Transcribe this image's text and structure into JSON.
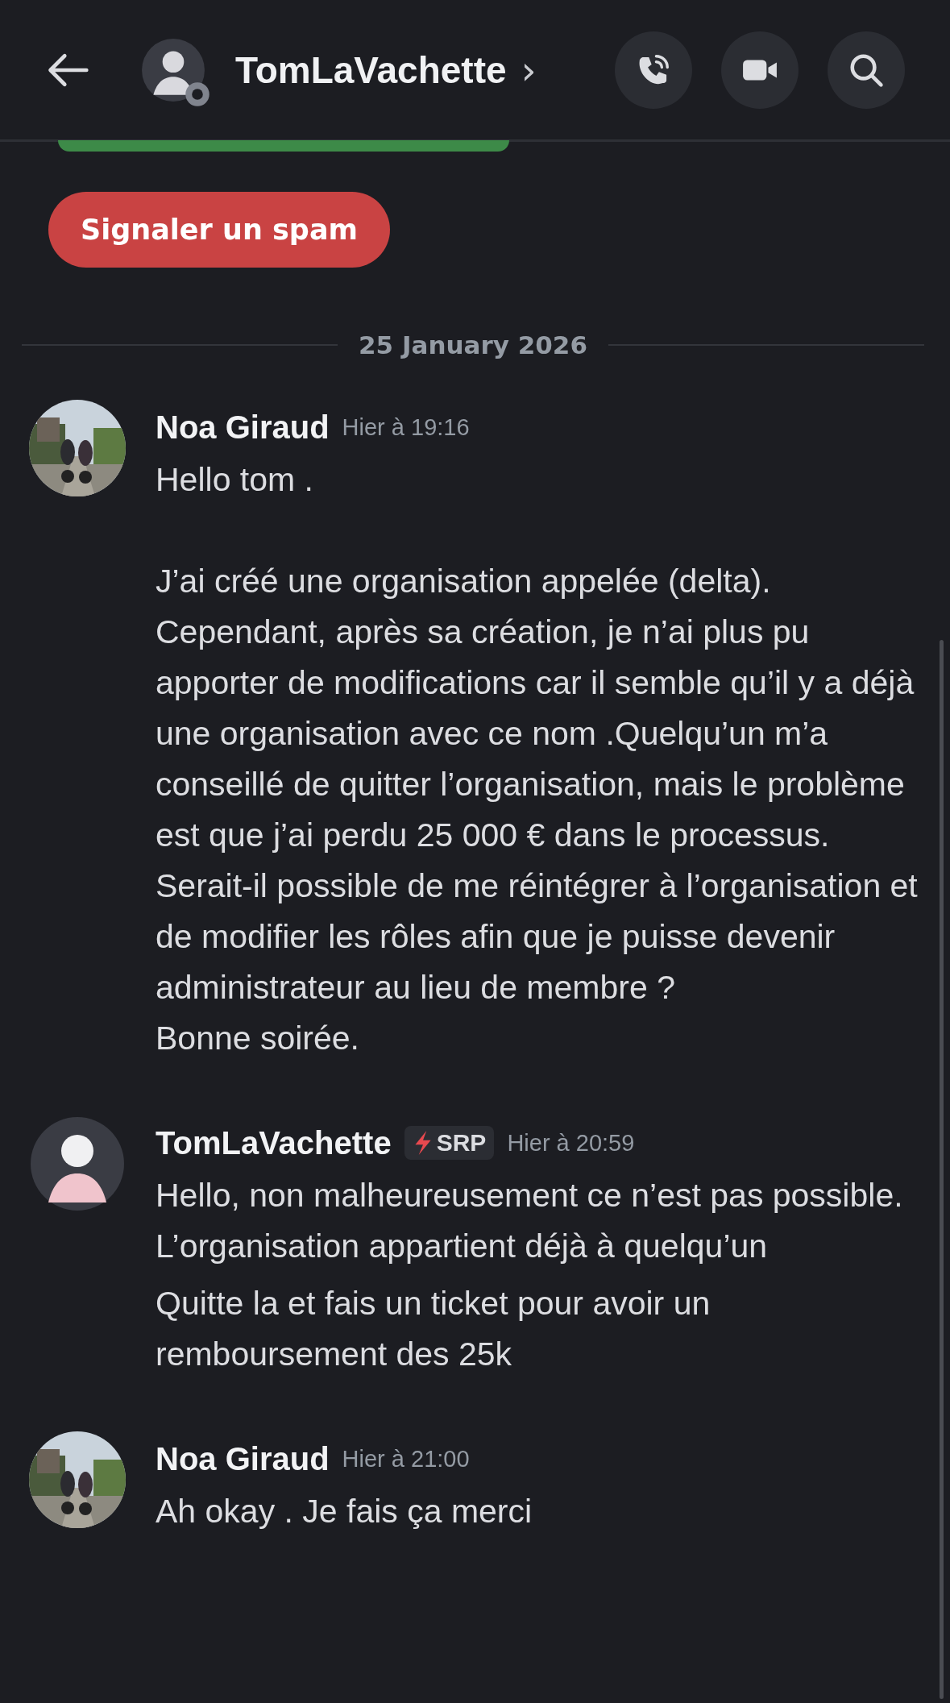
{
  "header": {
    "title": "TomLaVachette",
    "chevron": "›",
    "offline": true
  },
  "spam_button": "Signaler un spam",
  "date_divider": "25 January 2026",
  "messages": [
    {
      "author": "Noa Giraud",
      "time": "Hier à 19:16",
      "paragraphs": [
        "Hello tom .\n\nJ’ai créé une organisation appelée (delta). Cependant, après sa création, je n’ai plus pu apporter de modifications car il semble qu’il y a déjà une organisation avec ce nom .Quelqu’un m’a conseillé de quitter l’organisation, mais le problème est que j’ai perdu 25 000 € dans le processus. Serait-il possible de me réintégrer à l’organisation et de modifier les rôles afin que je puisse devenir administrateur au lieu de membre ?\nBonne soirée."
      ]
    },
    {
      "author": "TomLaVachette",
      "kind": "cartoon",
      "badge": "SRP",
      "time": "Hier à 20:59",
      "paragraphs": [
        "Hello, non malheureusement ce n’est pas possible. L’organisation appartient déjà à quelqu’un",
        "Quitte la et fais un ticket pour avoir un remboursement des 25k"
      ]
    },
    {
      "author": "Noa Giraud",
      "time": "Hier à 21:00",
      "paragraphs": [
        "Ah okay . Je fais ça merci"
      ]
    }
  ]
}
